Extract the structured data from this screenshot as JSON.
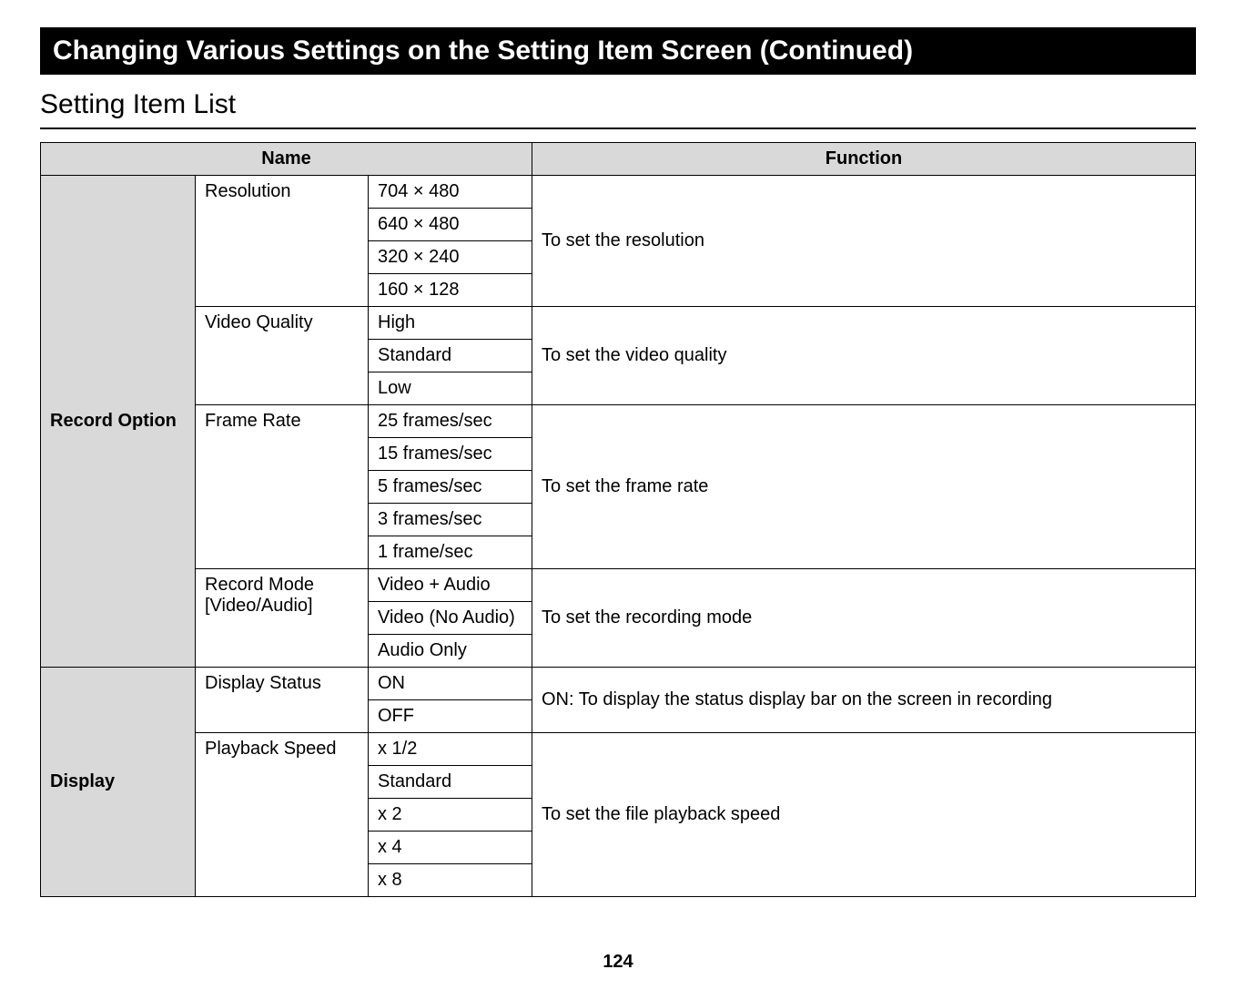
{
  "heading": "Changing Various Settings on the Setting Item Screen (Continued)",
  "subheading": "Setting Item List",
  "columns": {
    "name": "Name",
    "function": "Function"
  },
  "categories": {
    "record_option": "Record Option",
    "display": "Display"
  },
  "settings": {
    "resolution": {
      "label": "Resolution",
      "options": [
        "704 × 480",
        "640 × 480",
        "320 × 240",
        "160 × 128"
      ],
      "function": "To set the resolution"
    },
    "video_quality": {
      "label": "Video Quality",
      "options": [
        "High",
        "Standard",
        "Low"
      ],
      "function": "To set the video quality"
    },
    "frame_rate": {
      "label": "Frame Rate",
      "options": [
        "25 frames/sec",
        "15 frames/sec",
        "5 frames/sec",
        "3 frames/sec",
        "1 frame/sec"
      ],
      "function": "To set the frame rate"
    },
    "record_mode": {
      "label_line1": "Record Mode",
      "label_line2": "[Video/Audio]",
      "options": [
        "Video + Audio",
        "Video (No Audio)",
        "Audio Only"
      ],
      "function": "To set the recording mode"
    },
    "display_status": {
      "label": "Display Status",
      "options": [
        "ON",
        "OFF"
      ],
      "function": "ON: To display the status display bar on the screen in recording"
    },
    "playback_speed": {
      "label": "Playback Speed",
      "options": [
        "x 1/2",
        "Standard",
        "x 2",
        "x 4",
        "x 8"
      ],
      "function": "To set the file playback speed"
    }
  },
  "page_number": "124"
}
